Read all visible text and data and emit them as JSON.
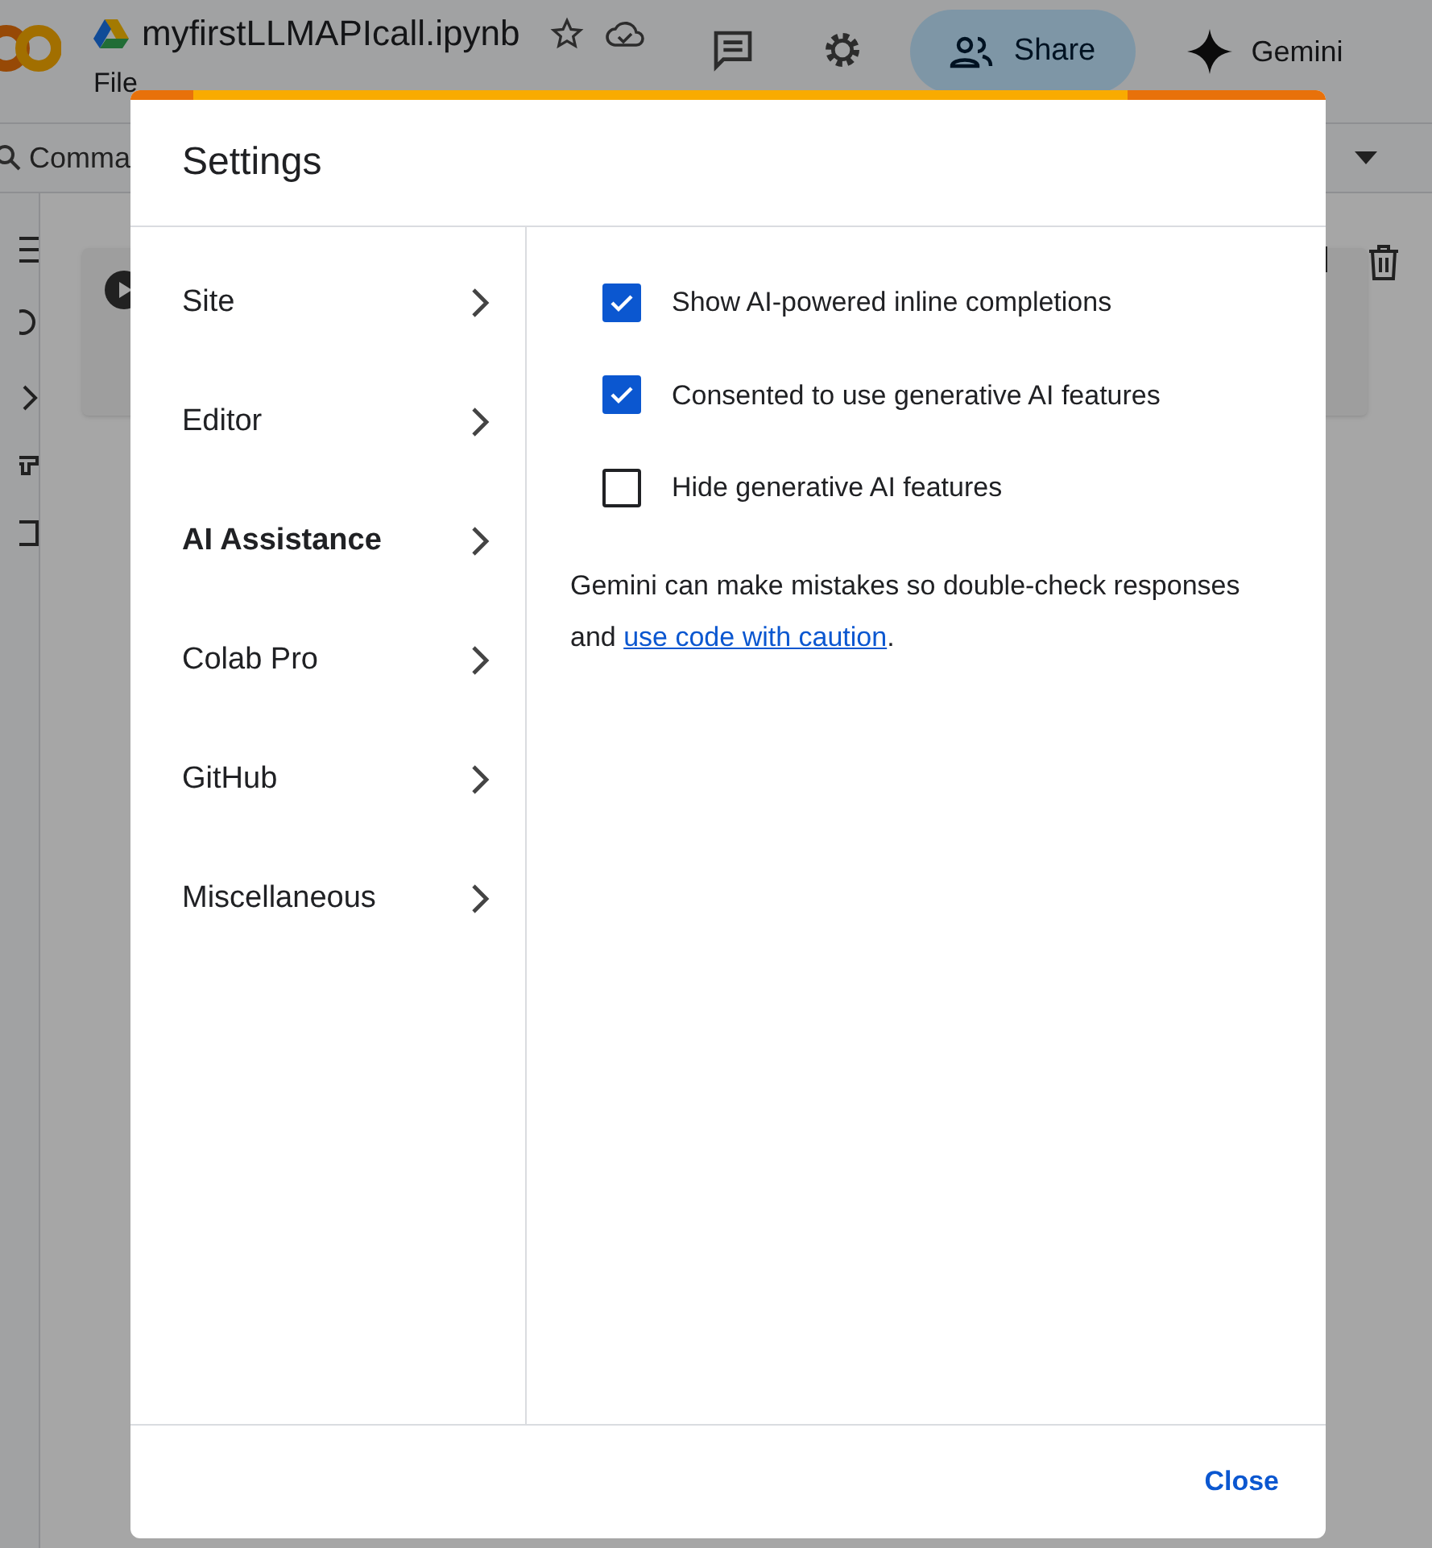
{
  "app": {
    "document_title": "myfirstLLMAPIcall.ipynb",
    "menu": [
      "File"
    ],
    "share_label": "Share",
    "gemini_label": "Gemini",
    "command_search": "Comma"
  },
  "dialog": {
    "title": "Settings",
    "nav": [
      {
        "label": "Site",
        "selected": false
      },
      {
        "label": "Editor",
        "selected": false
      },
      {
        "label": "AI Assistance",
        "selected": true
      },
      {
        "label": "Colab Pro",
        "selected": false
      },
      {
        "label": "GitHub",
        "selected": false
      },
      {
        "label": "Miscellaneous",
        "selected": false
      }
    ],
    "options": [
      {
        "label": "Show AI-powered inline completions",
        "checked": true
      },
      {
        "label": "Consented to use generative AI features",
        "checked": true
      },
      {
        "label": "Hide generative AI features",
        "checked": false
      }
    ],
    "note": "Gemini can make mistakes so double-check responses and ",
    "note_link": "use code with caution",
    "note_end": ".",
    "close_label": "Close"
  }
}
